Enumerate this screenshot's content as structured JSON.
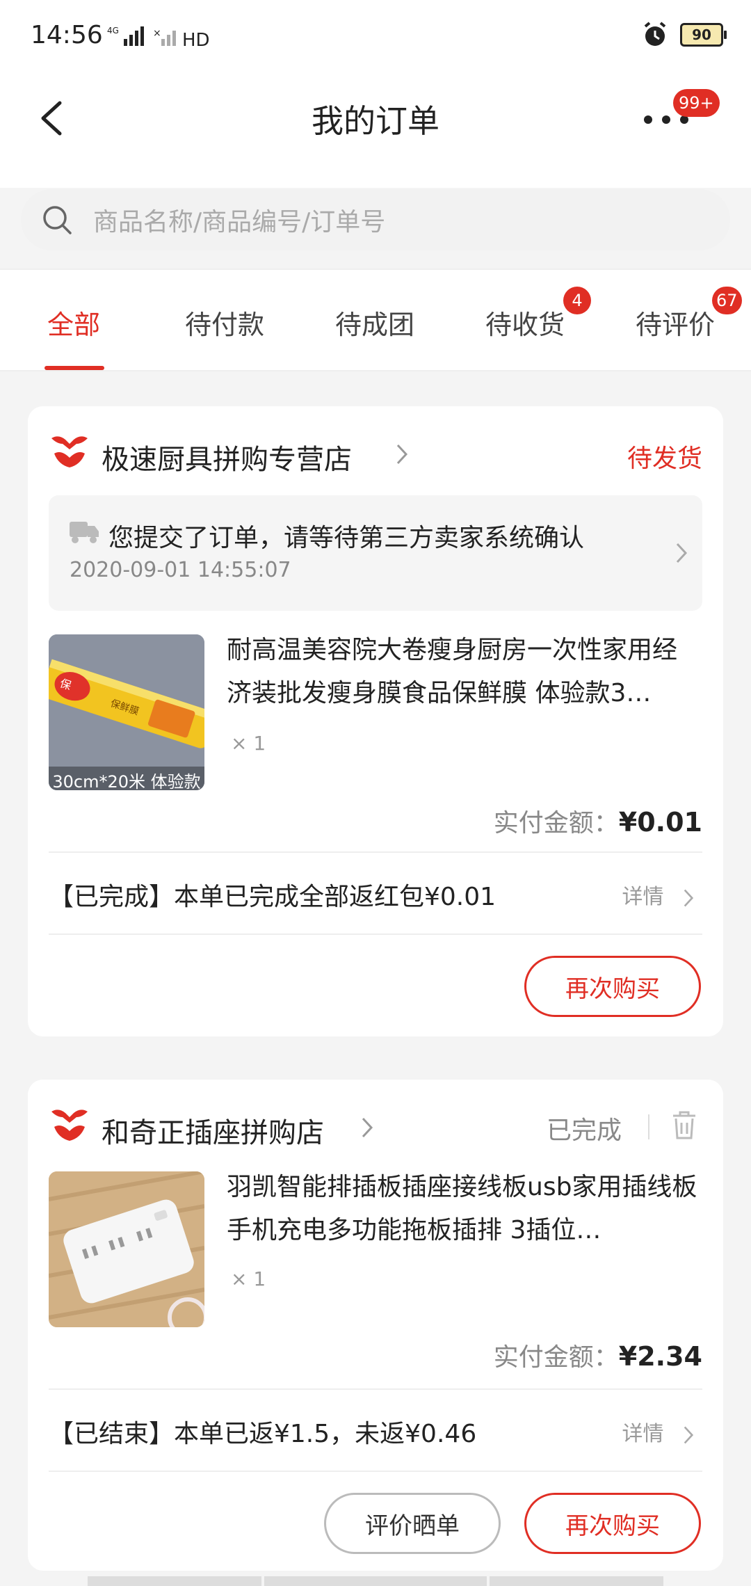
{
  "status_bar": {
    "time": "14:56",
    "network": "4G",
    "hd": "HD",
    "battery": "90"
  },
  "header": {
    "title": "我的订单",
    "more_badge": "99+"
  },
  "search": {
    "placeholder": "商品名称/商品编号/订单号"
  },
  "tabs": [
    {
      "label": "全部",
      "badge": ""
    },
    {
      "label": "待付款",
      "badge": ""
    },
    {
      "label": "待成团",
      "badge": ""
    },
    {
      "label": "待收货",
      "badge": "4"
    },
    {
      "label": "待评价",
      "badge": "67"
    }
  ],
  "orders": [
    {
      "shop": "极速厨具拼购专营店",
      "status": "待发货",
      "notice_text": "您提交了订单，请等待第三方卖家系统确认",
      "notice_time": "2020-09-01 14:55:07",
      "product_title": "耐高温美容院大卷瘦身厨房一次性家用经济装批发瘦身膜食品保鲜膜 体验款3…",
      "thumb_caption": "30cm*20米 体验款",
      "thumb_label": "保鲜膜",
      "qty": "× 1",
      "pay_label": "实付金额：",
      "pay_amount": "¥0.01",
      "refund_text": "【已完成】本单已完成全部返红包¥0.01",
      "detail_label": "详情",
      "buttons": [
        "再次购买"
      ]
    },
    {
      "shop": "和奇正插座拼购店",
      "status": "已完成",
      "product_title": "羽凯智能排插板插座接线板usb家用插线板手机充电多功能拖板插排 3插位…",
      "qty": "× 1",
      "pay_label": "实付金额：",
      "pay_amount": "¥2.34",
      "refund_text": "【已结束】本单已返¥1.5，未返¥0.46",
      "detail_label": "详情",
      "buttons": [
        "评价晒单",
        "再次购买"
      ]
    }
  ],
  "colors": {
    "accent": "#e02e24",
    "background": "#f4f4f4"
  }
}
